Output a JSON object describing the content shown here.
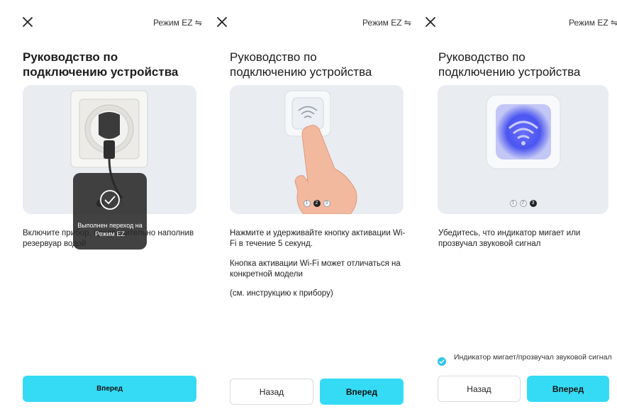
{
  "screens": [
    {
      "close_label": "×",
      "mode_label": "Режим EZ ⇋",
      "title": "Руководство по подключению устройства",
      "pagination": [
        "1",
        "2",
        "3"
      ],
      "active_step": 0,
      "description": "Включите прибор, предварительно наполнив резервуар водой",
      "toast_message": "Выполнен переход на Режим EZ",
      "next_label": "Вперед"
    },
    {
      "close_label": "×",
      "mode_label": "Режим EZ ⇋",
      "title": "Руководство по подключению устройства",
      "pagination": [
        "1",
        "2",
        "3"
      ],
      "active_step": 1,
      "description_1": "Нажмите и удерживайте кнопку активации Wi-Fi в течение 5 секунд.",
      "description_2": "Кнопка активации Wi-Fi может отличаться на конкретной модели",
      "description_3": "(см. инструкцию к прибору)",
      "back_label": "Назад",
      "next_label": "Вперед"
    },
    {
      "close_label": "×",
      "mode_label": "Режим EZ ⇋",
      "title": "Руководство по подключению устройства",
      "pagination": [
        "1",
        "2",
        "3"
      ],
      "active_step": 2,
      "description": "Убедитесь, что индикатор мигает или прозвучал звуковой сигнал",
      "checkbox_label": "Индикатор мигает/прозвучал звуковой сигнал",
      "checkbox_checked": true,
      "back_label": "Назад",
      "next_label": "Вперед"
    }
  ],
  "icons": {
    "close": "close-icon",
    "mode": "swap-arrows-icon",
    "toast": "checkmark-circle-icon",
    "wifi": "wifi-icon"
  },
  "colors": {
    "accent": "#35dbf5",
    "checkbox": "#32c3e8",
    "toast_bg": "#282828",
    "illustration_bg": "#e9edf2",
    "wifi_glow": "#5560ff"
  }
}
